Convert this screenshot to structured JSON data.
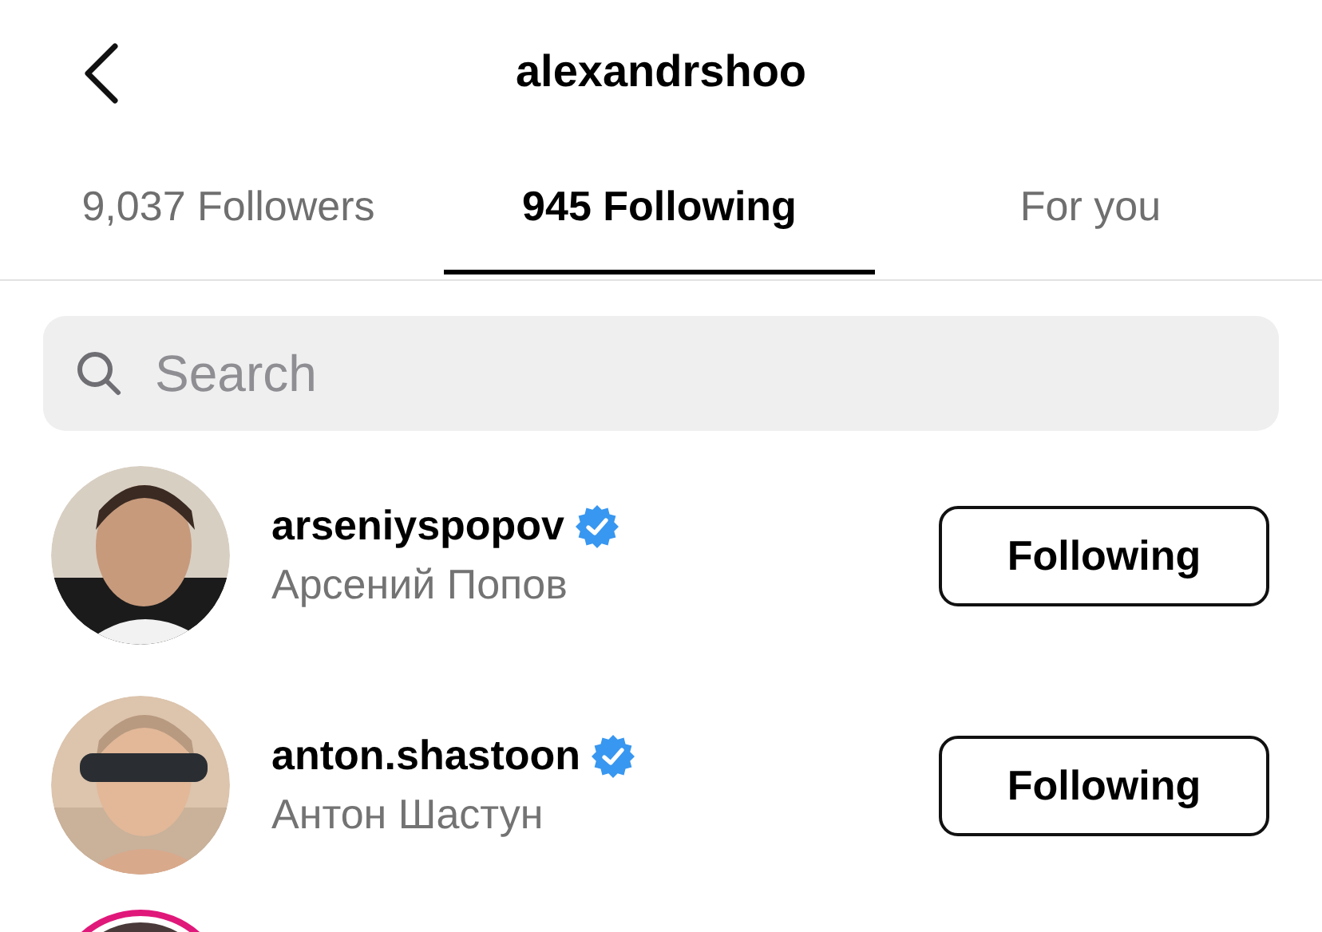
{
  "header": {
    "title": "alexandrshoo"
  },
  "tabs": [
    {
      "label": "9,037 Followers",
      "selected": false
    },
    {
      "label": "945 Following",
      "selected": true
    },
    {
      "label": "For you",
      "selected": false
    }
  ],
  "search": {
    "placeholder": "Search"
  },
  "accounts": [
    {
      "username": "arseniyspopov",
      "verified": true,
      "full_name": "Арсений Попов",
      "button": "Following",
      "story_ring": false
    },
    {
      "username": "anton.shastoon",
      "verified": true,
      "full_name": "Антон Шастун",
      "button": "Following",
      "story_ring": false
    },
    {
      "story_ring": true
    }
  ]
}
